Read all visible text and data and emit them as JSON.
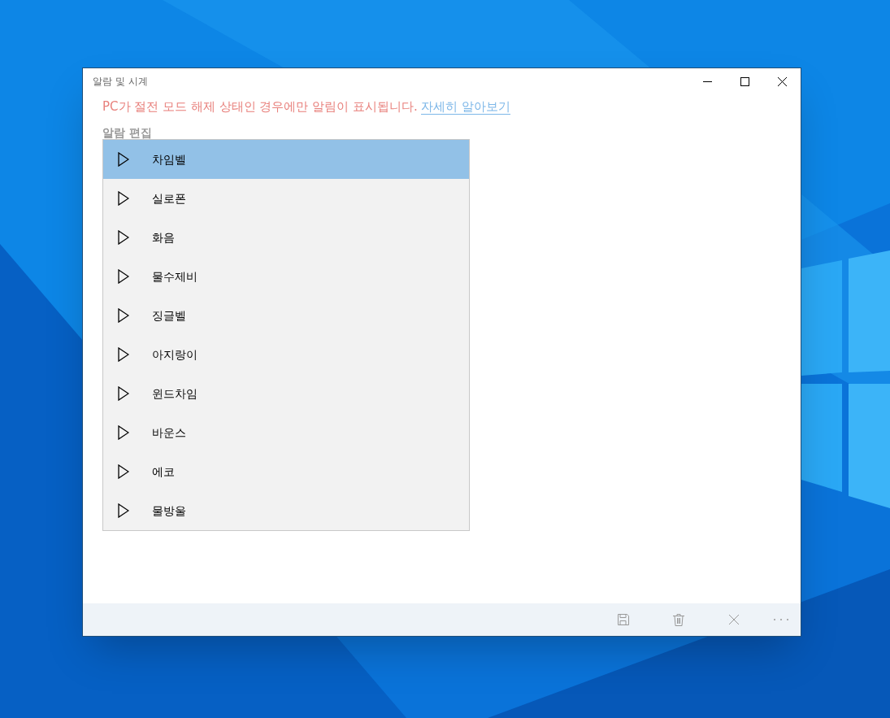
{
  "window": {
    "title": "알람 및 시계"
  },
  "notice": {
    "text": "PC가 절전 모드 해제 상태인 경우에만 알림이 표시됩니다.",
    "link": "자세히 알아보기"
  },
  "section_title": "알람 편집",
  "sounds": [
    {
      "label": "차임벨",
      "selected": true
    },
    {
      "label": "실로폰",
      "selected": false
    },
    {
      "label": "화음",
      "selected": false
    },
    {
      "label": "물수제비",
      "selected": false
    },
    {
      "label": "징글벨",
      "selected": false
    },
    {
      "label": "아지랑이",
      "selected": false
    },
    {
      "label": "윈드차임",
      "selected": false
    },
    {
      "label": "바운스",
      "selected": false
    },
    {
      "label": "에코",
      "selected": false
    },
    {
      "label": "물방울",
      "selected": false
    }
  ]
}
